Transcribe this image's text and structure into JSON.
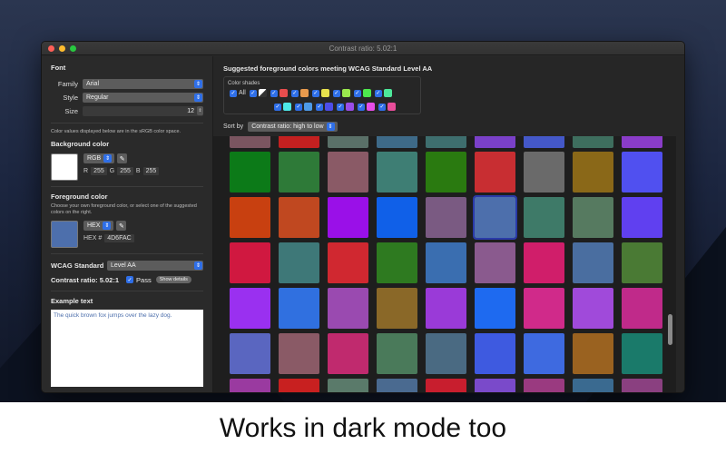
{
  "window": {
    "title": "Contrast ratio: 5.02:1"
  },
  "font": {
    "header": "Font",
    "family_label": "Family",
    "family_value": "Arial",
    "style_label": "Style",
    "style_value": "Regular",
    "size_label": "Size",
    "size_value": "12"
  },
  "color_space_note": "Color values displayed below are in the sRGB color space.",
  "background": {
    "header": "Background color",
    "swatch": "#FFFFFF",
    "mode": "RGB",
    "r_label": "R",
    "r": "255",
    "g_label": "G",
    "g": "255",
    "b_label": "B",
    "b": "255"
  },
  "foreground": {
    "header": "Foreground color",
    "note": "Choose your own foreground color, or select one of the suggested colors on the right.",
    "swatch": "#4D6FAC",
    "mode": "HEX",
    "hex_label": "HEX #",
    "hex": "4D6FAC"
  },
  "wcag": {
    "label": "WCAG Standard",
    "value": "Level AA"
  },
  "contrast": {
    "label": "Contrast ratio: 5.02:1",
    "pass_label": "Pass",
    "details_button": "Show details"
  },
  "example": {
    "header": "Example text",
    "text": "The quick brown fox jumps over the lazy dog."
  },
  "suggested": {
    "title": "Suggested foreground colors meeting WCAG Standard Level AA",
    "shades_label": "Color shades",
    "all_label": "All",
    "shade_row1": [
      "#E84D4D",
      "#E89A4D",
      "#E8E24D",
      "#9AE84D",
      "#4DE84D",
      "#4DE89A"
    ],
    "shade_row2": [
      "#4DE8E8",
      "#4D9AE8",
      "#4D4DE8",
      "#9A4DE8",
      "#E84DE8",
      "#E84D9A"
    ],
    "sort_label": "Sort by",
    "sort_value": "Contrast ratio: high to low"
  },
  "grid": {
    "row0": [
      "#7A5560",
      "#C42020",
      "#5A7068",
      "#3E6A88",
      "#3E6E6E",
      "#7A40C8",
      "#4458C8",
      "#3E6E5E",
      "#8A3CC8"
    ],
    "row1": [
      "#0C7A18",
      "#2E7A38",
      "#8A5A66",
      "#3E7E74",
      "#2A7A10",
      "#C82E32",
      "#6A6A6A",
      "#8A6818",
      "#5050F0"
    ],
    "row2": [
      "#C84010",
      "#C04820",
      "#9A10E8",
      "#1060E8",
      "#7A5A82",
      "#4D6FAC",
      "#3E7A68",
      "#567A60",
      "#6040F0"
    ],
    "row3": [
      "#D01840",
      "#3E7878",
      "#D02830",
      "#2E7A20",
      "#3A6EB0",
      "#8A5A8E",
      "#D01E6A",
      "#4A6EA0",
      "#4A7A34"
    ],
    "row4": [
      "#9A30F0",
      "#3070E0",
      "#9A4AB0",
      "#8A6828",
      "#9A3AD8",
      "#1E6AF0",
      "#D02A8A",
      "#A04ADA",
      "#C02A8A"
    ],
    "row5": [
      "#5A66C0",
      "#8A5A66",
      "#C02A6E",
      "#4A7A5A",
      "#4A6A82",
      "#3E5AE0",
      "#3E6AE0",
      "#9A6220",
      "#1A7A6A"
    ],
    "row6": [
      "#9A3AA0",
      "#C82020",
      "#5A7A6A",
      "#4A6A90",
      "#C81E2E",
      "#7A4ACA",
      "#9A3A80",
      "#3A6A90",
      "#8A4080"
    ]
  }
}
